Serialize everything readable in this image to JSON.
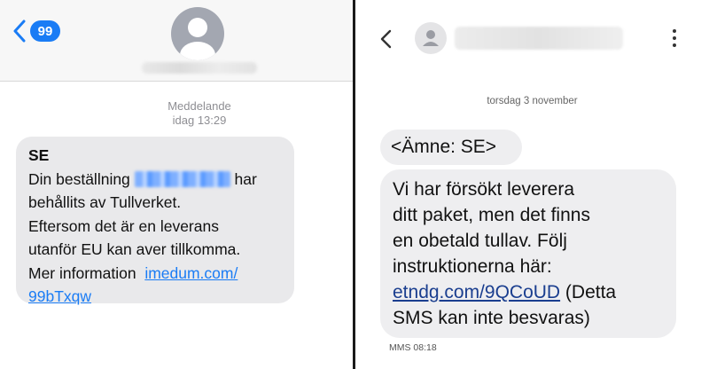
{
  "ios": {
    "badge": "99",
    "meta_line1": "Meddelande",
    "meta_line2": "idag 13:29",
    "message": {
      "title": "SE",
      "line1_prefix": "Din beställning",
      "line1_suffix": "har",
      "line2": "behållits av Tullverket.",
      "line3": "Eftersom det är en leverans",
      "line4": "utanför EU kan aver tillkomma.",
      "line5_prefix": "Mer information",
      "link_part1": "imedum.com/",
      "link_part2": "99bTxqw"
    }
  },
  "android": {
    "date": "torsdag 3 november",
    "subject": "<Ämne: SE>",
    "message": {
      "line1": "Vi har försökt leverera",
      "line2": "ditt paket, men det finns",
      "line3": "en obetald tullav. Följ",
      "line4": "instruktionerna här:",
      "link": "etndg.com/9QCoUD",
      "line5_suffix": " (Detta",
      "line6": "SMS kan inte besvaras)"
    },
    "timestamp": "MMS 08:18"
  },
  "colors": {
    "ios_accent": "#1a7cf5",
    "ios_bubble": "#e9e9eb",
    "android_bubble": "#eeeef0",
    "android_link": "#1a3e8f"
  },
  "icons": [
    "back-chevron-icon",
    "avatar-icon",
    "more-vertical-icon"
  ]
}
